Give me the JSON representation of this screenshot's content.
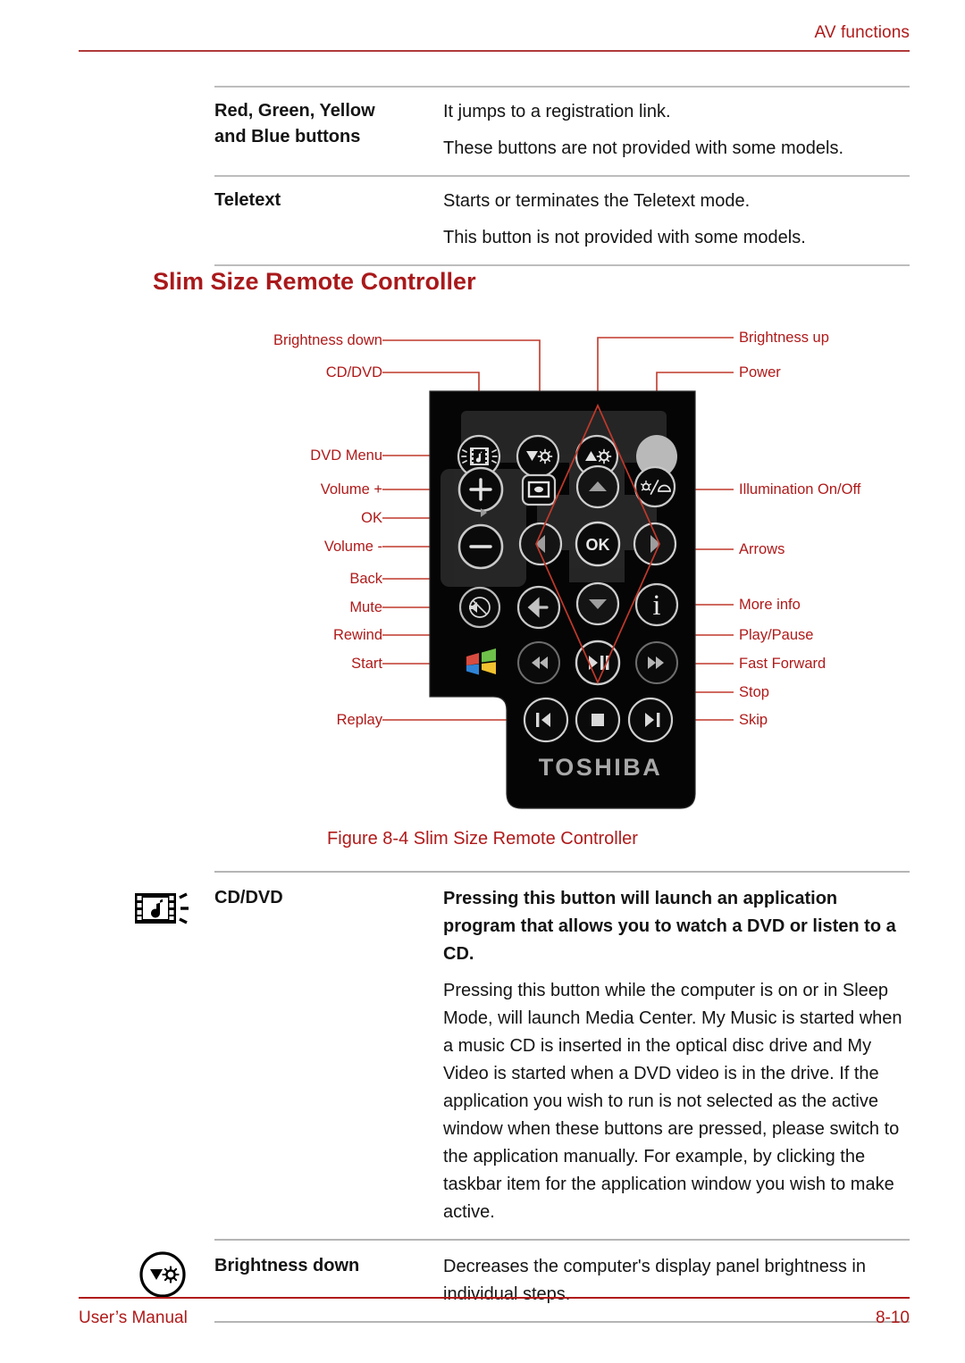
{
  "header": {
    "title": "AV functions"
  },
  "top_table": {
    "rows": [
      {
        "term": "Red, Green, Yellow and Blue buttons",
        "term_line1": "Red, Green, Yellow",
        "term_line2": "and Blue buttons",
        "paras": [
          "It jumps to a registration link.",
          "These buttons are not provided with some models."
        ]
      },
      {
        "term": "Teletext",
        "term_line1": "Teletext",
        "term_line2": "",
        "paras": [
          "Starts or terminates the Teletext mode.",
          "This button is not provided with some models."
        ]
      }
    ]
  },
  "section": {
    "heading": "Slim Size Remote Controller"
  },
  "figure": {
    "caption": "Figure 8-4 Slim Size Remote Controller",
    "brand": "TOSHIBA",
    "ok_label": "OK",
    "info_label": "i",
    "labels_left": [
      {
        "text": "Brightness down",
        "name": "callout-brightness-down"
      },
      {
        "text": "CD/DVD",
        "name": "callout-cd-dvd"
      },
      {
        "text": "DVD Menu",
        "name": "callout-dvd-menu"
      },
      {
        "text": "Volume +",
        "name": "callout-volume-up"
      },
      {
        "text": "OK",
        "name": "callout-ok"
      },
      {
        "text": "Volume -",
        "name": "callout-volume-down"
      },
      {
        "text": "Back",
        "name": "callout-back"
      },
      {
        "text": "Mute",
        "name": "callout-mute"
      },
      {
        "text": "Rewind",
        "name": "callout-rewind"
      },
      {
        "text": "Start",
        "name": "callout-start"
      },
      {
        "text": "Replay",
        "name": "callout-replay"
      }
    ],
    "labels_right": [
      {
        "text": "Brightness up",
        "name": "callout-brightness-up"
      },
      {
        "text": "Power",
        "name": "callout-power"
      },
      {
        "text": "Illumination On/Off",
        "name": "callout-illumination"
      },
      {
        "text": "Arrows",
        "name": "callout-arrows"
      },
      {
        "text": "More info",
        "name": "callout-more-info"
      },
      {
        "text": "Play/Pause",
        "name": "callout-play-pause"
      },
      {
        "text": "Fast Forward",
        "name": "callout-fast-forward"
      },
      {
        "text": "Stop",
        "name": "callout-stop"
      },
      {
        "text": "Skip",
        "name": "callout-skip"
      }
    ]
  },
  "bottom_table": {
    "rows": [
      {
        "icon": "cd-dvd-filmstrip-icon",
        "term": "CD/DVD",
        "paras": [
          "Pressing this button will launch an application program that allows you to watch a DVD or listen to a CD.",
          "Pressing this button while the computer is on or in Sleep Mode, will launch Media Center. My Music is started when a music CD is inserted in the optical disc drive and My Video is started when a DVD video is in the drive. If the application you wish to run is not selected as the active window when these buttons are pressed, please switch to the application manually. For example, by clicking the taskbar item for the application window you wish to make active."
        ]
      },
      {
        "icon": "brightness-down-icon",
        "term": "Brightness down",
        "paras": [
          "Decreases the computer's display panel brightness in individual steps."
        ]
      }
    ]
  },
  "footer": {
    "left": "User’s Manual",
    "right": "8-10"
  },
  "colors": {
    "accent_red": "#b01a1a",
    "heading_red": "#a9191b",
    "rule_gray": "#bdbdbd"
  }
}
